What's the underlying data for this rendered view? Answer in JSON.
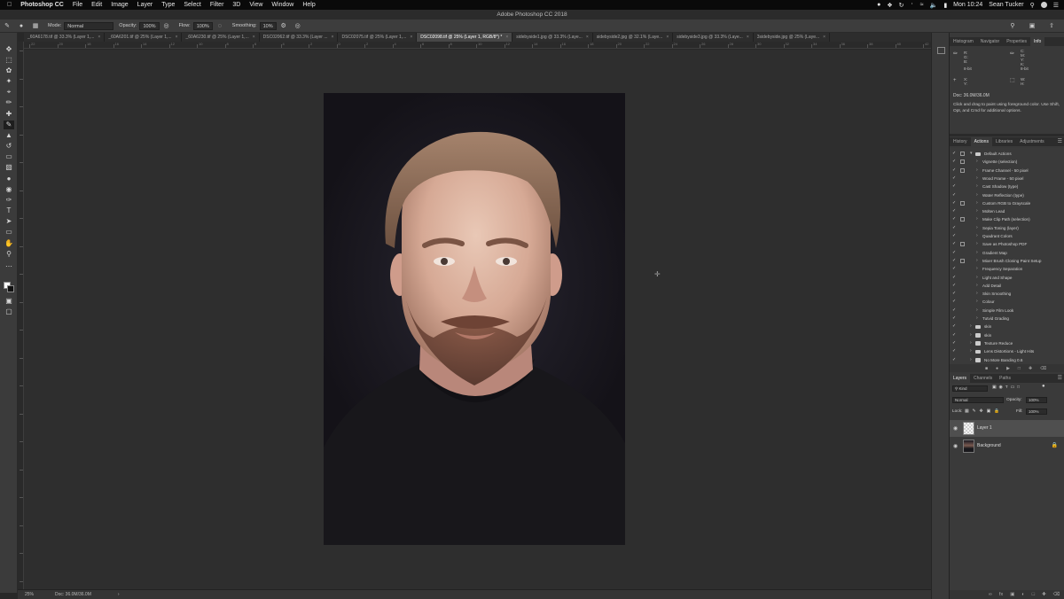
{
  "menubar": {
    "app_name": "Photoshop CC",
    "items": [
      "File",
      "Edit",
      "Image",
      "Layer",
      "Type",
      "Select",
      "Filter",
      "3D",
      "View",
      "Window",
      "Help"
    ],
    "clock": "Mon 10:24",
    "user": "Sean Tucker"
  },
  "window": {
    "title": "Adobe Photoshop CC 2018"
  },
  "options_bar": {
    "mode_label": "Mode:",
    "mode_value": "Normal",
    "opacity_label": "Opacity:",
    "opacity_value": "100%",
    "flow_label": "Flow:",
    "flow_value": "100%",
    "smoothing_label": "Smoothing:",
    "smoothing_value": "10%"
  },
  "doc_tabs": [
    {
      "label": "_60A6178.tif @ 33.3% (Layer 1,...",
      "active": false
    },
    {
      "label": "_60A6201.tif @ 25% (Layer 1,...",
      "active": false
    },
    {
      "label": "_60A6230.tif @ 25% (Layer 1,...",
      "active": false
    },
    {
      "label": "DSC02062.tif @ 33.3% (Layer ...",
      "active": false
    },
    {
      "label": "DSC02075.tif @ 25% (Layer 1,...",
      "active": false
    },
    {
      "label": "DSC02098.tif @ 25% (Layer 1, RGB/8*) *",
      "active": true
    },
    {
      "label": "sidebyside1.jpg @ 33.3% (Laye...",
      "active": false
    },
    {
      "label": "sidebyside2.jpg @ 32.1% (Laye...",
      "active": false
    },
    {
      "label": "sidebyside3.jpg @ 33.3% (Laye...",
      "active": false
    },
    {
      "label": "3sidebyside.jpg @ 25% (Laye...",
      "active": false
    }
  ],
  "ruler_labels": [
    "22",
    "20",
    "18",
    "16",
    "14",
    "12",
    "10",
    "8",
    "6",
    "4",
    "2",
    "0",
    "2",
    "4",
    "6",
    "8",
    "10",
    "12",
    "14",
    "16",
    "18",
    "20",
    "22",
    "24",
    "26",
    "28",
    "30",
    "32",
    "34",
    "36",
    "38",
    "40",
    "42"
  ],
  "status_bar": {
    "zoom": "25%",
    "doc": "Doc: 36.0M/36.0M"
  },
  "info_panel": {
    "tabs": [
      "Histogram",
      "Navigator",
      "Properties",
      "Info"
    ],
    "active_tab": "Info",
    "rgb_left": "R:\nG:\nB:",
    "cmyk_right": "C:\nM:\nY:\nK:",
    "bits_left": "8-bit",
    "bits_right": "8-bit",
    "xy": "X:\nY:",
    "wh": "W:\nH:",
    "doc": "Doc: 36.0M/36.0M",
    "hint": "Click and drag to paint using foreground color. Use Shift, Opt, and Cmd for additional options."
  },
  "actions_panel": {
    "tabs": [
      "History",
      "Actions",
      "Libraries",
      "Adjustments"
    ],
    "active_tab": "Actions",
    "items": [
      {
        "label": "Default Actions",
        "kind": "set",
        "dialog": true
      },
      {
        "label": "Vignette (selection)",
        "kind": "action",
        "dialog": true
      },
      {
        "label": "Frame Channel - 50 pixel",
        "kind": "action",
        "dialog": true
      },
      {
        "label": "Wood Frame - 50 pixel",
        "kind": "action",
        "dialog": false
      },
      {
        "label": "Cast Shadow (type)",
        "kind": "action",
        "dialog": false
      },
      {
        "label": "Water Reflection (type)",
        "kind": "action",
        "dialog": false
      },
      {
        "label": "Custom RGB to Grayscale",
        "kind": "action",
        "dialog": true
      },
      {
        "label": "Molten Lead",
        "kind": "action",
        "dialog": false
      },
      {
        "label": "Make Clip Path (selection)",
        "kind": "action",
        "dialog": true
      },
      {
        "label": "Sepia Toning (layer)",
        "kind": "action",
        "dialog": false
      },
      {
        "label": "Quadrant Colors",
        "kind": "action",
        "dialog": false
      },
      {
        "label": "Save as Photoshop PDF",
        "kind": "action",
        "dialog": true
      },
      {
        "label": "Gradient Map",
        "kind": "action",
        "dialog": false
      },
      {
        "label": "Mixer Brush Cloning Paint Setup",
        "kind": "action",
        "dialog": true
      },
      {
        "label": "Frequency Separation",
        "kind": "action",
        "dialog": false
      },
      {
        "label": "Light and Shape",
        "kind": "action",
        "dialog": false
      },
      {
        "label": "Add Detail",
        "kind": "action",
        "dialog": false
      },
      {
        "label": "Skin Smoothing",
        "kind": "action",
        "dialog": false
      },
      {
        "label": "Colour",
        "kind": "action",
        "dialog": false
      },
      {
        "label": "Simple Film Look",
        "kind": "action",
        "dialog": false
      },
      {
        "label": "Tutvid Grading",
        "kind": "action",
        "dialog": false
      },
      {
        "label": "skin",
        "kind": "folder",
        "dialog": false
      },
      {
        "label": "skin",
        "kind": "folder",
        "dialog": false
      },
      {
        "label": "Texture Reduce",
        "kind": "folder",
        "dialog": false
      },
      {
        "label": "Lens Distortions - Light Hits",
        "kind": "folder",
        "dialog": false
      },
      {
        "label": "No More Banding 0.6",
        "kind": "folder",
        "dialog": false
      }
    ]
  },
  "layers_panel": {
    "tabs": [
      "Layers",
      "Channels",
      "Paths"
    ],
    "active_tab": "Layers",
    "filter_label": "Kind",
    "blend_mode": "Normal",
    "opacity_label": "Opacity:",
    "opacity_value": "100%",
    "lock_label": "Lock:",
    "fill_label": "Fill:",
    "fill_value": "100%",
    "layers": [
      {
        "name": "Layer 1",
        "selected": true,
        "locked": false
      },
      {
        "name": "Background",
        "selected": false,
        "locked": true
      }
    ]
  },
  "colors": {
    "workspace_bg": "#282828",
    "panel_bg": "#393939",
    "canvas_bg": "#2e2e2e",
    "photo_bg": "#1c1a22"
  }
}
